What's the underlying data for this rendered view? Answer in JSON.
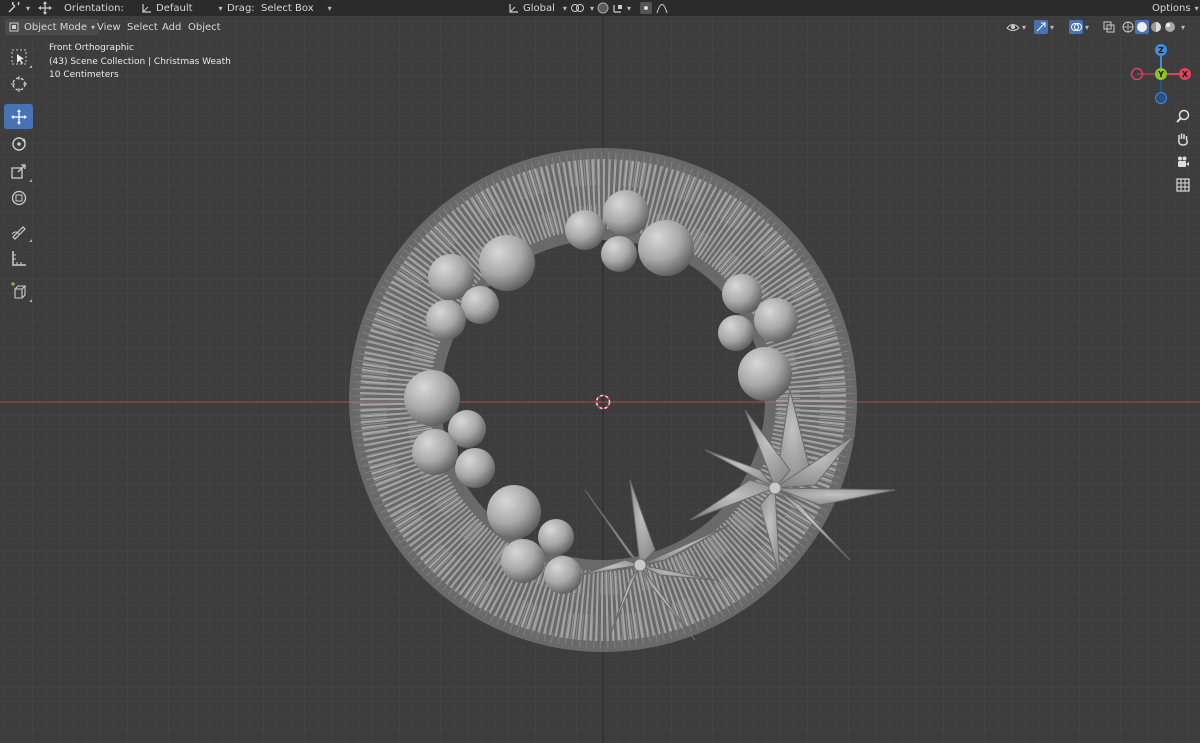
{
  "tool_header": {
    "orientation_label": "Orientation:",
    "orientation_value": "Default",
    "drag_label": "Drag:",
    "drag_value": "Select Box",
    "transform_orientation": "Global",
    "options_label": "Options"
  },
  "view_header": {
    "mode": "Object Mode",
    "menus": [
      "View",
      "Select",
      "Add",
      "Object"
    ]
  },
  "overlay": {
    "view_name": "Front Orthographic",
    "collection": "(43) Scene Collection | Christmas Weath",
    "scale": "10 Centimeters"
  },
  "toolbar": {
    "tools": [
      "select-box",
      "cursor",
      "move",
      "rotate",
      "scale",
      "transform",
      "annotate",
      "measure",
      "add-cube"
    ],
    "active_tool": "move"
  },
  "gizmo": {
    "axes": [
      "Z",
      "Y",
      "X"
    ],
    "colors": {
      "x": "#e4405b",
      "y": "#8bc42c",
      "z": "#3d8de3"
    }
  },
  "nav_buttons": [
    "zoom-icon",
    "pan-hand-icon",
    "camera-icon",
    "grid-toggle-icon"
  ],
  "colors": {
    "header_bg": "#2b2b2b",
    "viewport_bg": "#3d3d3d",
    "active_tool": "#4772b3",
    "x_axis_line": "#a04545"
  }
}
